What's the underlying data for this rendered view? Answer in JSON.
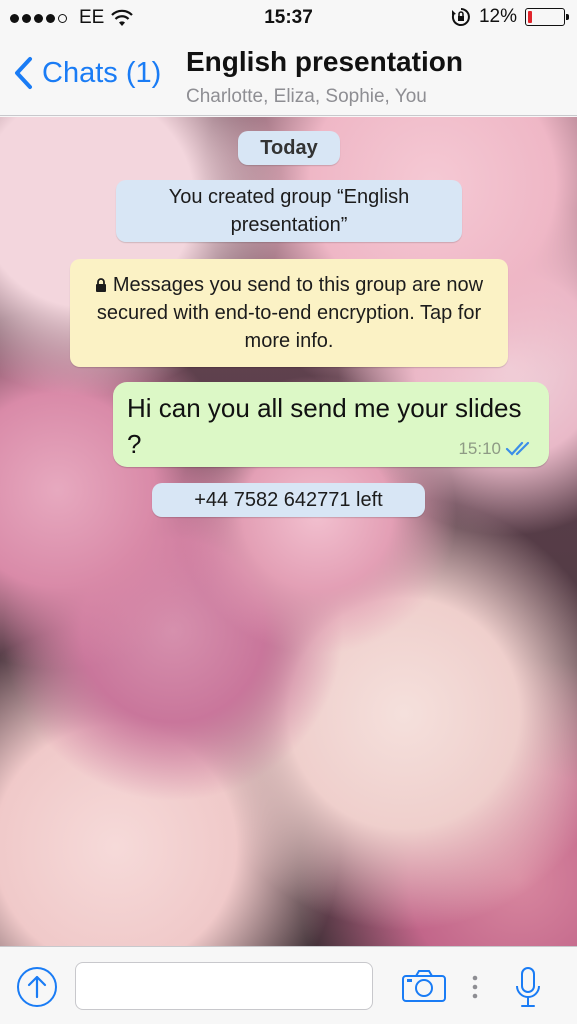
{
  "status_bar": {
    "carrier": "EE",
    "time": "15:37",
    "battery_percent": "12%",
    "battery_level": 0.12,
    "signal_bars_filled": 4,
    "signal_bars_total": 5,
    "icons": [
      "signal-dots",
      "wifi",
      "rotation-lock",
      "battery"
    ]
  },
  "nav": {
    "back_label": "Chats (1)",
    "title": "English presentation",
    "subtitle": "Charlotte, Eliza, Sophie, You"
  },
  "chat": {
    "date_label": "Today",
    "system_created": "You created group “English presentation”",
    "encryption_notice": "Messages you send to this group are now secured with end-to-end encryption. Tap for more info.",
    "message": {
      "text": "Hi can you all send me your slides ?",
      "time": "15:10",
      "status": "read-double-tick"
    },
    "system_left": "+44 7582 642771 left"
  },
  "input_bar": {
    "placeholder": "",
    "icons": [
      "share-icon",
      "camera-icon",
      "more-icon",
      "microphone-icon"
    ]
  },
  "colors": {
    "accent": "#1a7cf5",
    "outgoing_bubble": "#dcf8c6",
    "system_pill": "#d8e6f5",
    "encryption_pill": "#fbf2c5",
    "battery_low": "#e0242b"
  }
}
